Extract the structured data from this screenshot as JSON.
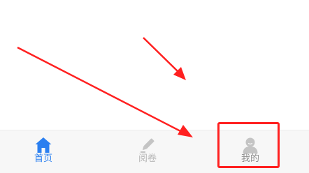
{
  "tabbar": {
    "tabs": [
      {
        "label": "首页",
        "icon": "home-icon",
        "active": true
      },
      {
        "label": "阅卷",
        "icon": "pencil-icon",
        "active": false
      },
      {
        "label": "我的",
        "icon": "user-icon",
        "active": false
      }
    ]
  },
  "colors": {
    "active": "#2a7ff0",
    "inactive": "#b8b8b8",
    "annotation": "#ff2020"
  }
}
